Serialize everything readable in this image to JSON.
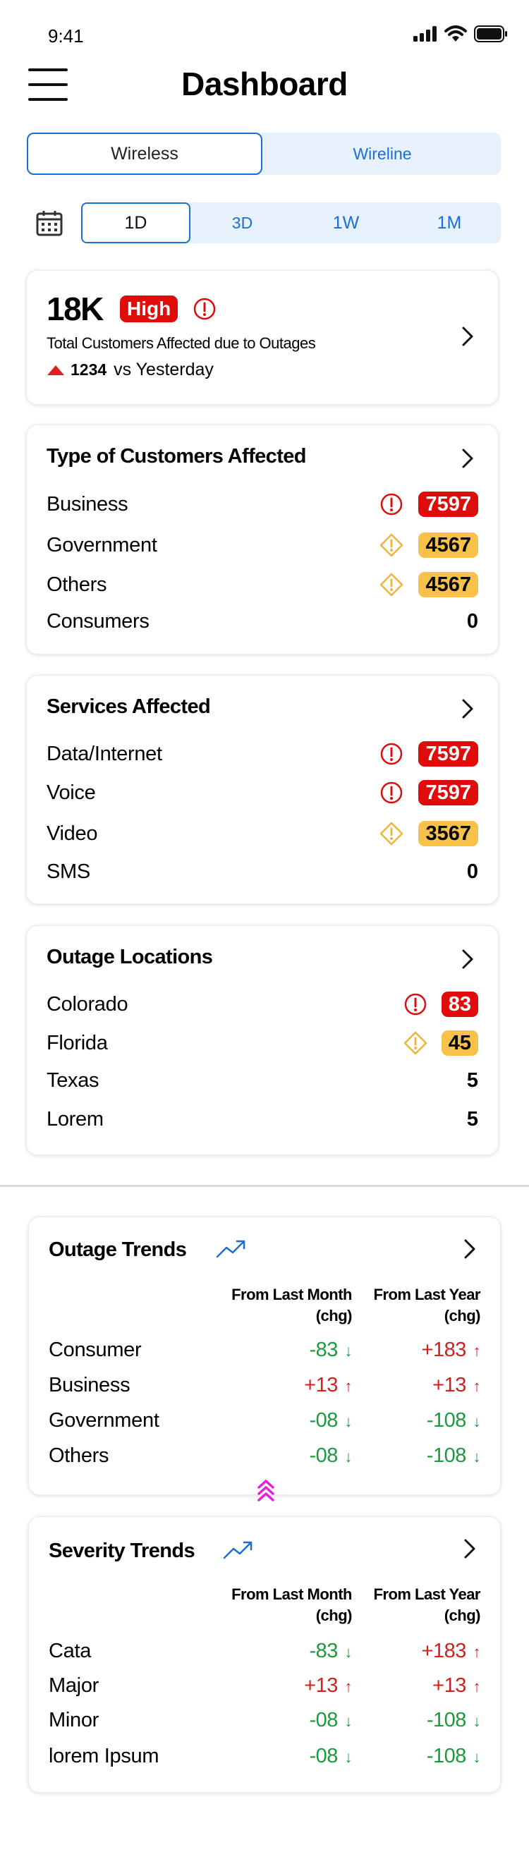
{
  "status": {
    "time": "9:41"
  },
  "header": {
    "title": "Dashboard"
  },
  "network_tabs": {
    "active": "Wireless",
    "inactive": "Wireline"
  },
  "periods": [
    "1D",
    "3D",
    "1W",
    "1M"
  ],
  "kpi": {
    "value": "18K",
    "level": "High",
    "description": "Total Customers Affected due to Outages",
    "delta_value": "1234",
    "delta_text": "vs Yesterday"
  },
  "customers": {
    "title": "Type of Customers Affected",
    "rows": [
      {
        "label": "Business",
        "value": "7597",
        "severity": "critical"
      },
      {
        "label": "Government",
        "value": "4567",
        "severity": "warning"
      },
      {
        "label": "Others",
        "value": "4567",
        "severity": "warning"
      },
      {
        "label": "Consumers",
        "value": "0",
        "severity": "none"
      }
    ]
  },
  "services": {
    "title": "Services Affected",
    "rows": [
      {
        "label": "Data/Internet",
        "value": "7597",
        "severity": "critical"
      },
      {
        "label": "Voice",
        "value": "7597",
        "severity": "critical"
      },
      {
        "label": "Video",
        "value": "3567",
        "severity": "warning"
      },
      {
        "label": "SMS",
        "value": "0",
        "severity": "none"
      }
    ]
  },
  "locations": {
    "title": "Outage Locations",
    "rows": [
      {
        "label": "Colorado",
        "value": "83",
        "severity": "critical"
      },
      {
        "label": "Florida",
        "value": "45",
        "severity": "warning"
      },
      {
        "label": "Texas",
        "value": "5",
        "severity": "none"
      },
      {
        "label": "Lorem",
        "value": "5",
        "severity": "none"
      }
    ]
  },
  "outage_trends": {
    "title": "Outage Trends",
    "col1": [
      "From Last Month",
      "(chg)"
    ],
    "col2": [
      "From Last Year",
      "(chg)"
    ],
    "rows": [
      {
        "label": "Consumer",
        "month": "-83",
        "month_dir": "down",
        "year": "+183",
        "year_dir": "up"
      },
      {
        "label": "Business",
        "month": "+13",
        "month_dir": "up",
        "year": "+13",
        "year_dir": "up"
      },
      {
        "label": "Government",
        "month": "-08",
        "month_dir": "down",
        "year": "-108",
        "year_dir": "down"
      },
      {
        "label": "Others",
        "month": "-08",
        "month_dir": "down",
        "year": "-108",
        "year_dir": "down"
      }
    ]
  },
  "severity_trends": {
    "title": "Severity Trends",
    "col1": [
      "From Last Month",
      "(chg)"
    ],
    "col2": [
      "From Last Year",
      "(chg)"
    ],
    "rows": [
      {
        "label": "Cata",
        "month": "-83",
        "month_dir": "down",
        "year": "+183",
        "year_dir": "up"
      },
      {
        "label": "Major",
        "month": "+13",
        "month_dir": "up",
        "year": "+13",
        "year_dir": "up"
      },
      {
        "label": "Minor",
        "month": "-08",
        "month_dir": "down",
        "year": "-108",
        "year_dir": "down"
      },
      {
        "label": "lorem Ipsum",
        "month": "-08",
        "month_dir": "down",
        "year": "-108",
        "year_dir": "down"
      }
    ]
  },
  "colors": {
    "accent": "#1a6fd4",
    "critical": "#e00b0b",
    "warning": "#f7c14a",
    "up": "#d41f1f",
    "down": "#189c3c",
    "scroll_hint": "#e61fd8"
  }
}
